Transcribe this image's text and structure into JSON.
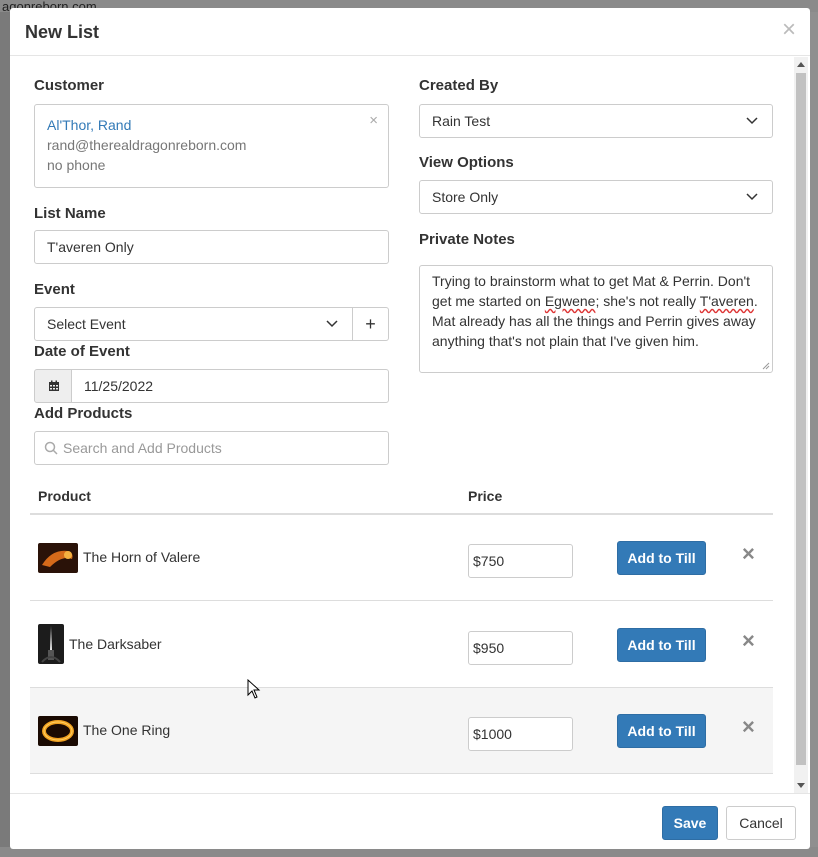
{
  "background": {
    "url_fragment": "agonreborn.com"
  },
  "modal": {
    "title": "New List",
    "close_glyph": "×"
  },
  "customer": {
    "label": "Customer",
    "name": "Al'Thor, Rand",
    "email": "rand@therealdragonreborn.com",
    "phone": "no phone",
    "clear_glyph": "×"
  },
  "list_name": {
    "label": "List Name",
    "value": "T'averen Only"
  },
  "event": {
    "label": "Event",
    "value": "Select Event",
    "add_glyph": "+"
  },
  "date_of_event": {
    "label": "Date of Event",
    "value": "11/25/2022"
  },
  "add_products": {
    "label": "Add Products",
    "placeholder": "Search and Add Products"
  },
  "created_by": {
    "label": "Created By",
    "value": "Rain Test"
  },
  "view_options": {
    "label": "View Options",
    "value": "Store Only"
  },
  "private_notes": {
    "label": "Private Notes",
    "line1": "Trying to brainstorm what to get Mat & Perrin. Don't",
    "line2_a": "get me started on ",
    "line2_b": "Egwene",
    "line2_c": "; she's not really ",
    "line2_d": "T'averen",
    "line2_e": ".",
    "line3": "Mat already has all the things and Perrin gives away",
    "line4": "anything that's not plain that I've given him."
  },
  "table": {
    "headers": {
      "product": "Product",
      "price": "Price"
    },
    "currency": "$",
    "add_label": "Add to Till",
    "remove_glyph": "×",
    "rows": [
      {
        "name": "The Horn of Valere",
        "price": "750"
      },
      {
        "name": "The Darksaber",
        "price": "950"
      },
      {
        "name": "The One Ring",
        "price": "1000"
      }
    ]
  },
  "footer": {
    "save": "Save",
    "cancel": "Cancel"
  },
  "colors": {
    "primary": "#337ab7",
    "link": "#337ab7",
    "border": "#cccccc"
  }
}
